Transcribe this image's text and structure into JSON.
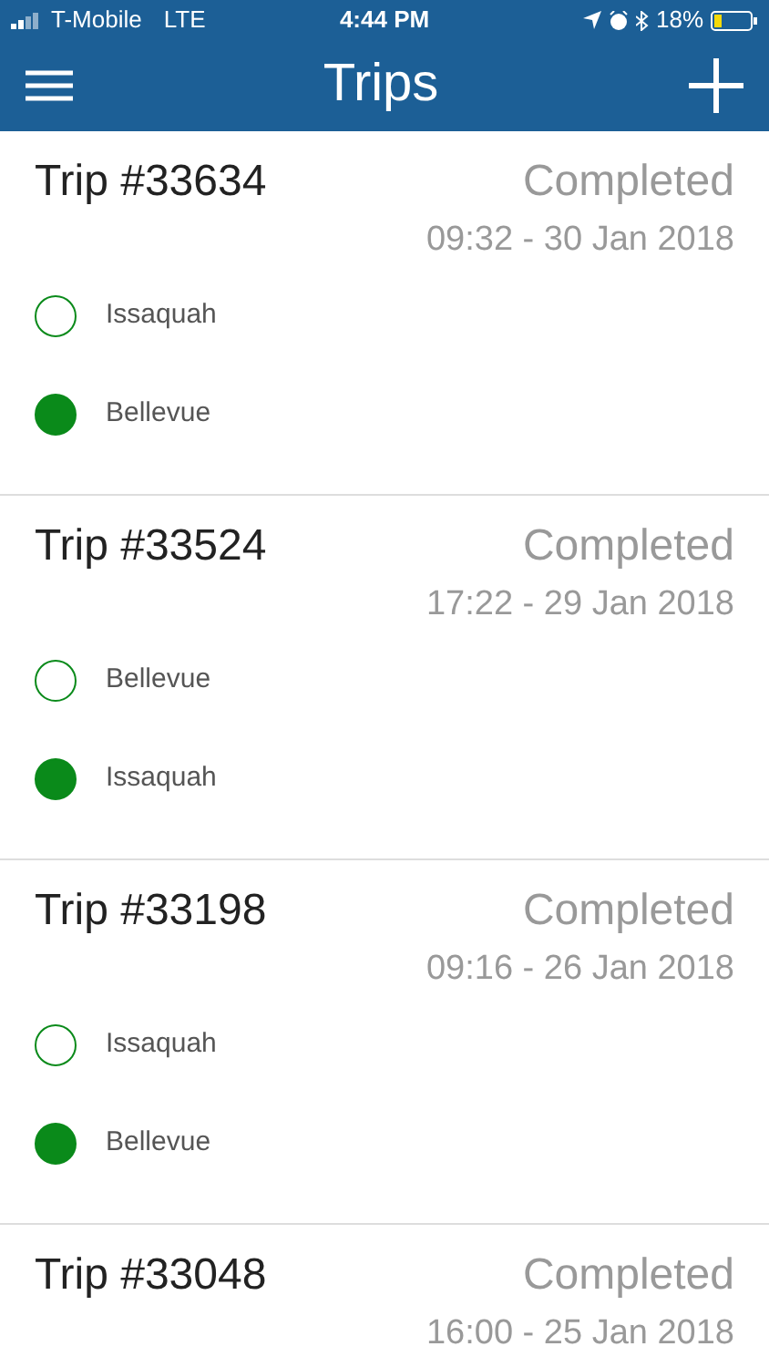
{
  "status_bar": {
    "carrier": "T-Mobile",
    "network": "LTE",
    "time": "4:44 PM",
    "battery": "18%"
  },
  "header": {
    "title": "Trips"
  },
  "trips": [
    {
      "title": "Trip #33634",
      "status": "Completed",
      "datetime": "09:32 - 30 Jan 2018",
      "stops": [
        {
          "kind": "origin",
          "name": "Issaquah"
        },
        {
          "kind": "destination",
          "name": "Bellevue"
        }
      ]
    },
    {
      "title": "Trip #33524",
      "status": "Completed",
      "datetime": "17:22 - 29 Jan 2018",
      "stops": [
        {
          "kind": "origin",
          "name": "Bellevue"
        },
        {
          "kind": "destination",
          "name": "Issaquah"
        }
      ]
    },
    {
      "title": "Trip #33198",
      "status": "Completed",
      "datetime": "09:16 - 26 Jan 2018",
      "stops": [
        {
          "kind": "origin",
          "name": "Issaquah"
        },
        {
          "kind": "destination",
          "name": "Bellevue"
        }
      ]
    },
    {
      "title": "Trip #33048",
      "status": "Completed",
      "datetime": "16:00 - 25 Jan 2018"
    }
  ]
}
